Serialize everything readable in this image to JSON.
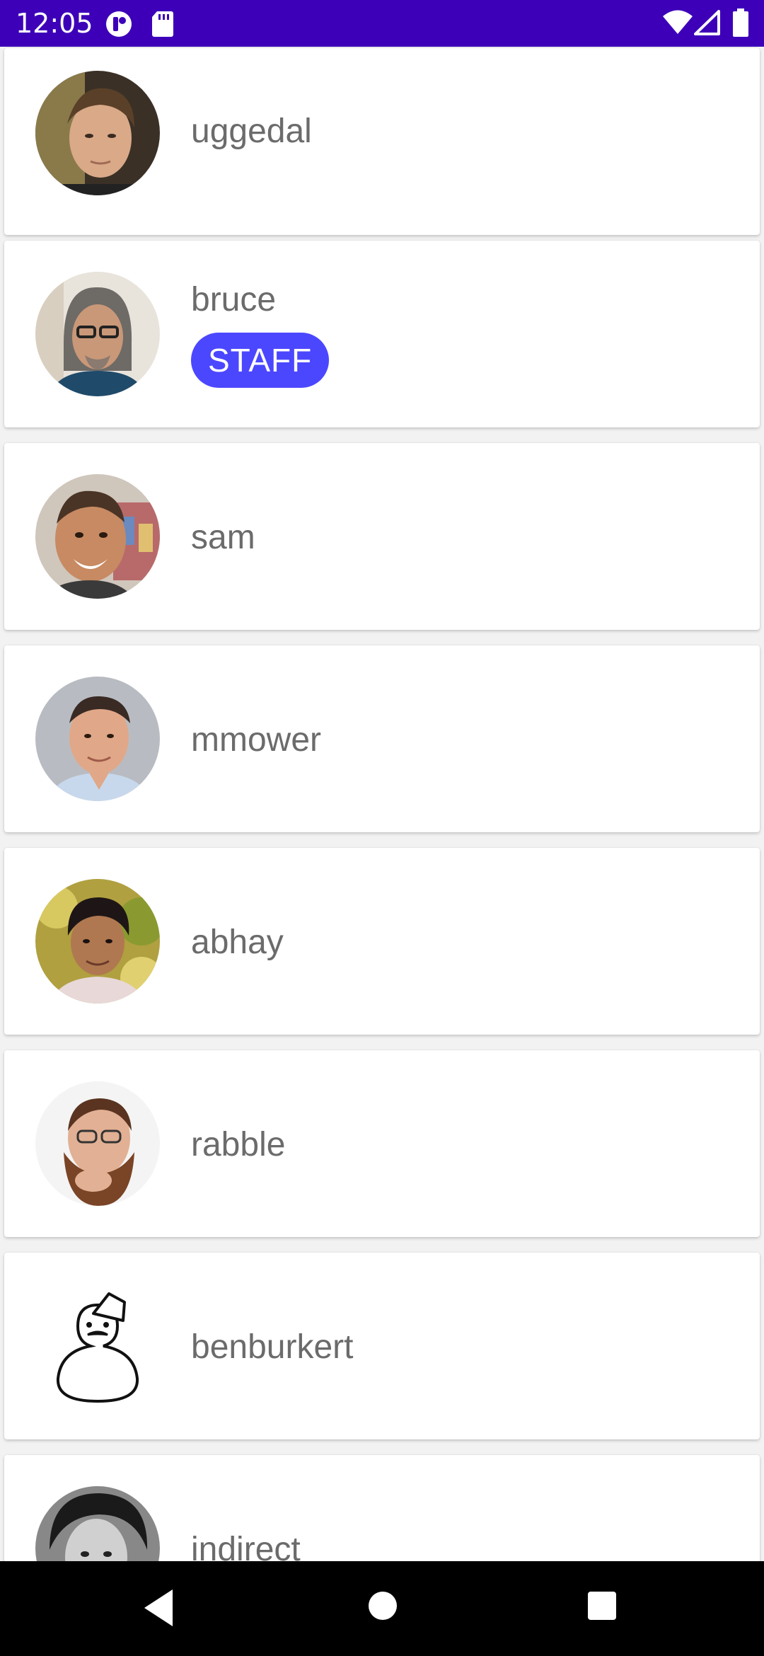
{
  "status_bar": {
    "time": "12:05",
    "icons": [
      "privacy-indicator-icon",
      "sd-card-icon",
      "wifi-icon",
      "cellular-signal-icon",
      "battery-icon"
    ]
  },
  "users": [
    {
      "name": "uggedal",
      "badge": null,
      "avatar": "photo"
    },
    {
      "name": "bruce",
      "badge": "STAFF",
      "avatar": "photo"
    },
    {
      "name": "sam",
      "badge": null,
      "avatar": "photo"
    },
    {
      "name": "mmower",
      "badge": null,
      "avatar": "photo"
    },
    {
      "name": "abhay",
      "badge": null,
      "avatar": "photo"
    },
    {
      "name": "rabble",
      "badge": null,
      "avatar": "photo"
    },
    {
      "name": "benburkert",
      "badge": null,
      "avatar": "snowman-drawing"
    },
    {
      "name": "indirect",
      "badge": null,
      "avatar": "photo"
    }
  ],
  "nav_bar": {
    "buttons": [
      "back-icon",
      "home-icon",
      "recents-icon"
    ]
  },
  "colors": {
    "status_bar": "#3d00b8",
    "badge": "#4b47ff",
    "name_text": "#6b6b6b",
    "background": "#f2f2f2"
  }
}
